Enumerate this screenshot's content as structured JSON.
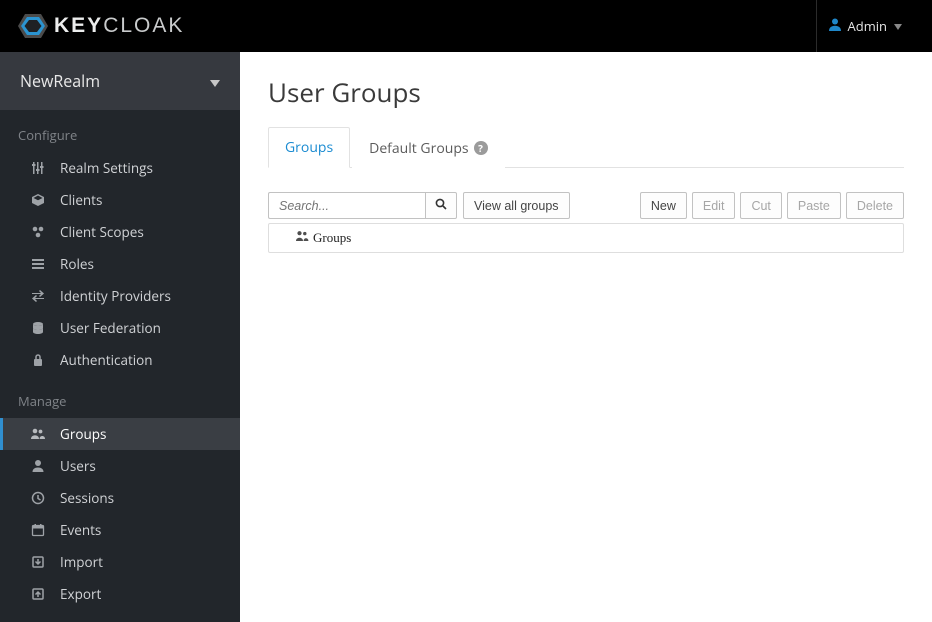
{
  "brand": {
    "name": "KEYCLOAK"
  },
  "user": {
    "name": "Admin"
  },
  "realm": {
    "name": "NewRealm"
  },
  "sidebar": {
    "sections": [
      {
        "title": "Configure",
        "items": [
          {
            "label": "Realm Settings"
          },
          {
            "label": "Clients"
          },
          {
            "label": "Client Scopes"
          },
          {
            "label": "Roles"
          },
          {
            "label": "Identity Providers"
          },
          {
            "label": "User Federation"
          },
          {
            "label": "Authentication"
          }
        ]
      },
      {
        "title": "Manage",
        "items": [
          {
            "label": "Groups"
          },
          {
            "label": "Users"
          },
          {
            "label": "Sessions"
          },
          {
            "label": "Events"
          },
          {
            "label": "Import"
          },
          {
            "label": "Export"
          }
        ]
      }
    ]
  },
  "page": {
    "title": "User Groups",
    "tabs": [
      {
        "label": "Groups"
      },
      {
        "label": "Default Groups"
      }
    ],
    "search": {
      "placeholder": "Search..."
    },
    "toolbar": {
      "view_all": "View all groups",
      "new": "New",
      "edit": "Edit",
      "cut": "Cut",
      "paste": "Paste",
      "delete": "Delete"
    },
    "tree": {
      "root": "Groups"
    }
  }
}
